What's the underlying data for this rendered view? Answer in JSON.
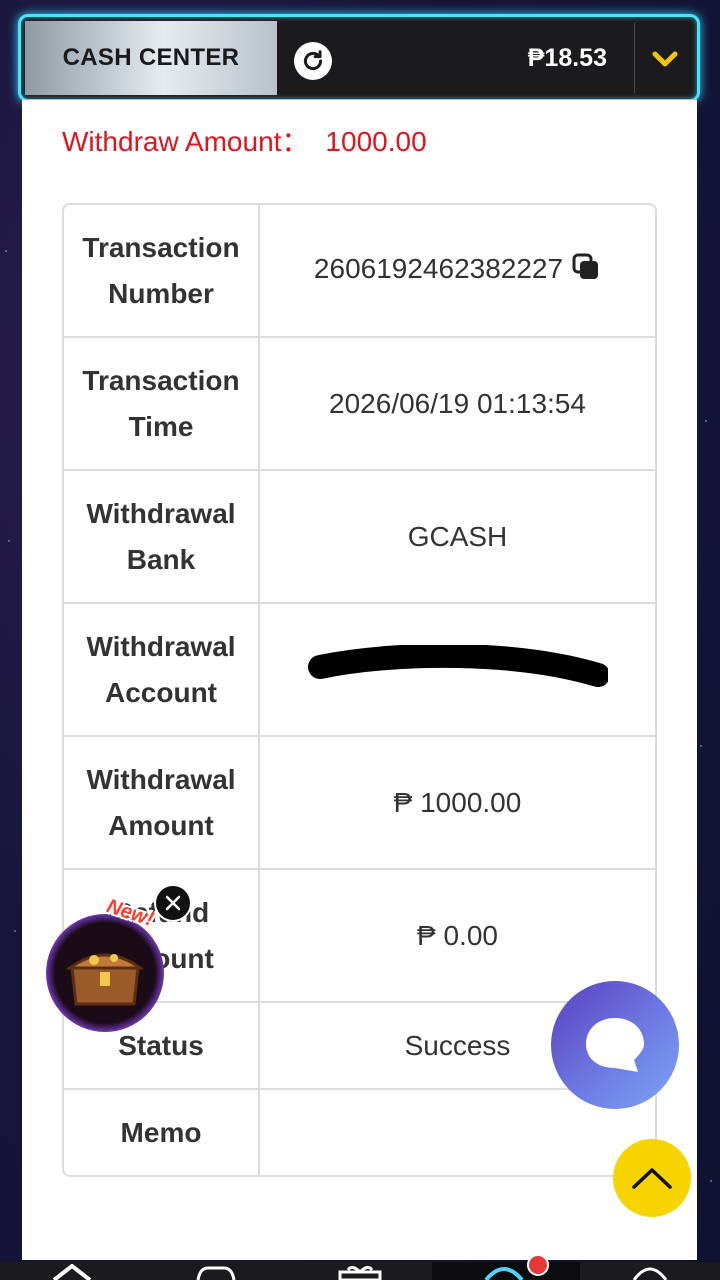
{
  "header": {
    "title": "CASH CENTER",
    "balance": "₱18.53",
    "accent_color": "#48e3ff",
    "icons": [
      "refresh-icon",
      "chevron-down-icon"
    ]
  },
  "withdraw_summary": {
    "label": "Withdraw Amount：",
    "value": "1000.00",
    "color": "#e1141d"
  },
  "transaction": {
    "rows": [
      {
        "label_line1": "Transaction",
        "label_line2": "Number",
        "value": "2606192462382227"
      },
      {
        "label_line1": "Transaction",
        "label_line2": "Time",
        "value": "2026/06/19 01:13:54"
      },
      {
        "label_line1": "Withdrawal",
        "label_line2": "Bank",
        "value": "GCASH"
      },
      {
        "label_line1": "Withdrawal",
        "label_line2": "Account",
        "value": ""
      },
      {
        "label_line1": "Withdrawal",
        "label_line2": "Amount",
        "value": "₱ 1000.00"
      },
      {
        "label_line1": "Refund",
        "label_line2": "Amount",
        "value": "₱ 0.00"
      },
      {
        "label": "Status",
        "value": "Success"
      },
      {
        "label": "Memo",
        "value": ""
      }
    ]
  },
  "floating": {
    "treasure_badge": "New!",
    "icons": [
      "treasure-chest-icon",
      "close-icon",
      "chat-icon",
      "arrow-up-icon"
    ]
  },
  "bottom_nav": {
    "icons": [
      "home-icon",
      "gamepad-icon",
      "gift-icon",
      "user-icon",
      "search-icon"
    ]
  }
}
